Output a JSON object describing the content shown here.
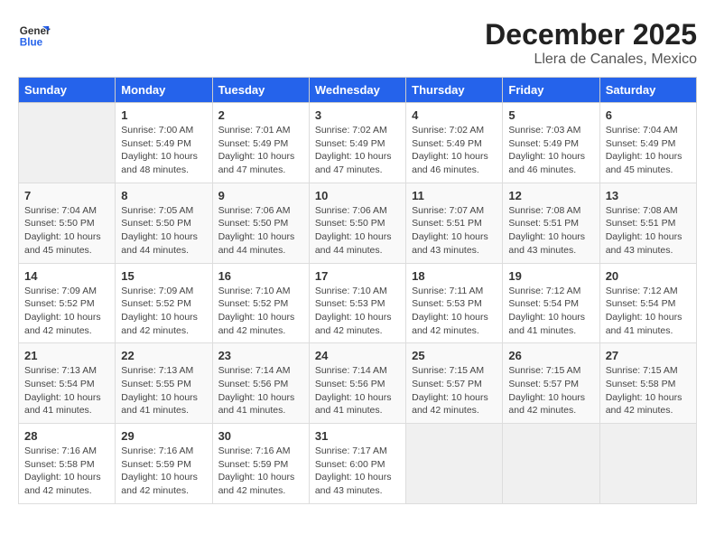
{
  "app": {
    "logo_line1": "General",
    "logo_line2": "Blue"
  },
  "calendar": {
    "title": "December 2025",
    "subtitle": "Llera de Canales, Mexico",
    "headers": [
      "Sunday",
      "Monday",
      "Tuesday",
      "Wednesday",
      "Thursday",
      "Friday",
      "Saturday"
    ],
    "weeks": [
      [
        {
          "day": "",
          "info": ""
        },
        {
          "day": "1",
          "info": "Sunrise: 7:00 AM\nSunset: 5:49 PM\nDaylight: 10 hours\nand 48 minutes."
        },
        {
          "day": "2",
          "info": "Sunrise: 7:01 AM\nSunset: 5:49 PM\nDaylight: 10 hours\nand 47 minutes."
        },
        {
          "day": "3",
          "info": "Sunrise: 7:02 AM\nSunset: 5:49 PM\nDaylight: 10 hours\nand 47 minutes."
        },
        {
          "day": "4",
          "info": "Sunrise: 7:02 AM\nSunset: 5:49 PM\nDaylight: 10 hours\nand 46 minutes."
        },
        {
          "day": "5",
          "info": "Sunrise: 7:03 AM\nSunset: 5:49 PM\nDaylight: 10 hours\nand 46 minutes."
        },
        {
          "day": "6",
          "info": "Sunrise: 7:04 AM\nSunset: 5:49 PM\nDaylight: 10 hours\nand 45 minutes."
        }
      ],
      [
        {
          "day": "7",
          "info": "Sunrise: 7:04 AM\nSunset: 5:50 PM\nDaylight: 10 hours\nand 45 minutes."
        },
        {
          "day": "8",
          "info": "Sunrise: 7:05 AM\nSunset: 5:50 PM\nDaylight: 10 hours\nand 44 minutes."
        },
        {
          "day": "9",
          "info": "Sunrise: 7:06 AM\nSunset: 5:50 PM\nDaylight: 10 hours\nand 44 minutes."
        },
        {
          "day": "10",
          "info": "Sunrise: 7:06 AM\nSunset: 5:50 PM\nDaylight: 10 hours\nand 44 minutes."
        },
        {
          "day": "11",
          "info": "Sunrise: 7:07 AM\nSunset: 5:51 PM\nDaylight: 10 hours\nand 43 minutes."
        },
        {
          "day": "12",
          "info": "Sunrise: 7:08 AM\nSunset: 5:51 PM\nDaylight: 10 hours\nand 43 minutes."
        },
        {
          "day": "13",
          "info": "Sunrise: 7:08 AM\nSunset: 5:51 PM\nDaylight: 10 hours\nand 43 minutes."
        }
      ],
      [
        {
          "day": "14",
          "info": "Sunrise: 7:09 AM\nSunset: 5:52 PM\nDaylight: 10 hours\nand 42 minutes."
        },
        {
          "day": "15",
          "info": "Sunrise: 7:09 AM\nSunset: 5:52 PM\nDaylight: 10 hours\nand 42 minutes."
        },
        {
          "day": "16",
          "info": "Sunrise: 7:10 AM\nSunset: 5:52 PM\nDaylight: 10 hours\nand 42 minutes."
        },
        {
          "day": "17",
          "info": "Sunrise: 7:10 AM\nSunset: 5:53 PM\nDaylight: 10 hours\nand 42 minutes."
        },
        {
          "day": "18",
          "info": "Sunrise: 7:11 AM\nSunset: 5:53 PM\nDaylight: 10 hours\nand 42 minutes."
        },
        {
          "day": "19",
          "info": "Sunrise: 7:12 AM\nSunset: 5:54 PM\nDaylight: 10 hours\nand 41 minutes."
        },
        {
          "day": "20",
          "info": "Sunrise: 7:12 AM\nSunset: 5:54 PM\nDaylight: 10 hours\nand 41 minutes."
        }
      ],
      [
        {
          "day": "21",
          "info": "Sunrise: 7:13 AM\nSunset: 5:54 PM\nDaylight: 10 hours\nand 41 minutes."
        },
        {
          "day": "22",
          "info": "Sunrise: 7:13 AM\nSunset: 5:55 PM\nDaylight: 10 hours\nand 41 minutes."
        },
        {
          "day": "23",
          "info": "Sunrise: 7:14 AM\nSunset: 5:56 PM\nDaylight: 10 hours\nand 41 minutes."
        },
        {
          "day": "24",
          "info": "Sunrise: 7:14 AM\nSunset: 5:56 PM\nDaylight: 10 hours\nand 41 minutes."
        },
        {
          "day": "25",
          "info": "Sunrise: 7:15 AM\nSunset: 5:57 PM\nDaylight: 10 hours\nand 42 minutes."
        },
        {
          "day": "26",
          "info": "Sunrise: 7:15 AM\nSunset: 5:57 PM\nDaylight: 10 hours\nand 42 minutes."
        },
        {
          "day": "27",
          "info": "Sunrise: 7:15 AM\nSunset: 5:58 PM\nDaylight: 10 hours\nand 42 minutes."
        }
      ],
      [
        {
          "day": "28",
          "info": "Sunrise: 7:16 AM\nSunset: 5:58 PM\nDaylight: 10 hours\nand 42 minutes."
        },
        {
          "day": "29",
          "info": "Sunrise: 7:16 AM\nSunset: 5:59 PM\nDaylight: 10 hours\nand 42 minutes."
        },
        {
          "day": "30",
          "info": "Sunrise: 7:16 AM\nSunset: 5:59 PM\nDaylight: 10 hours\nand 42 minutes."
        },
        {
          "day": "31",
          "info": "Sunrise: 7:17 AM\nSunset: 6:00 PM\nDaylight: 10 hours\nand 43 minutes."
        },
        {
          "day": "",
          "info": ""
        },
        {
          "day": "",
          "info": ""
        },
        {
          "day": "",
          "info": ""
        }
      ]
    ]
  }
}
